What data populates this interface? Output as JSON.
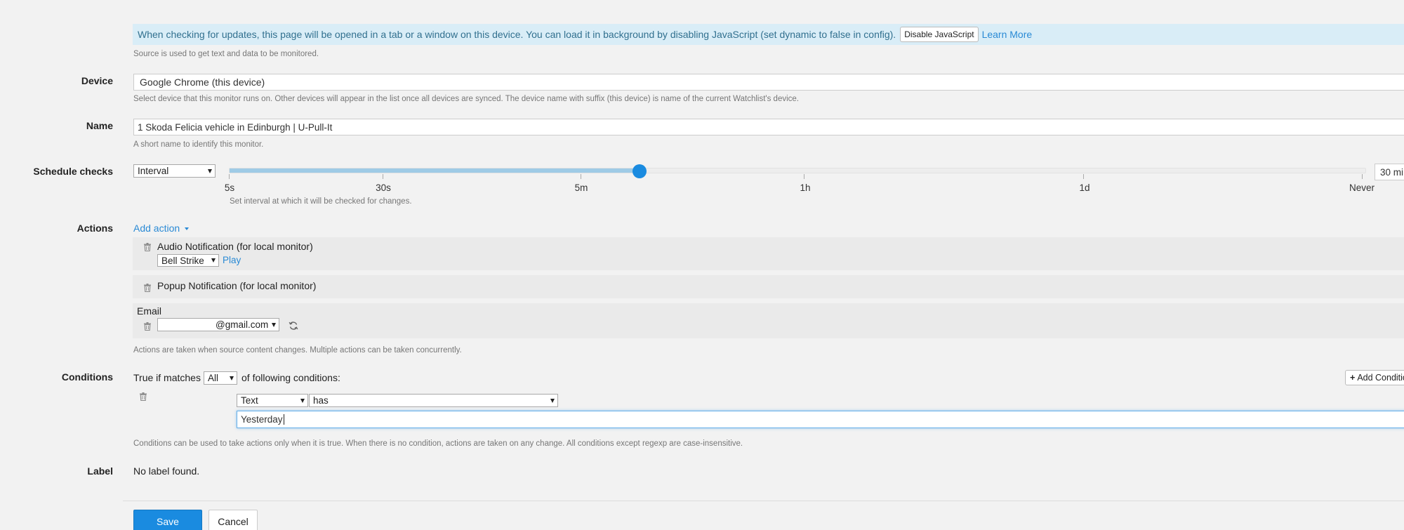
{
  "info": {
    "message": "When checking for updates, this page will be opened in a tab or a window on this device. You can load it in background by disabling JavaScript (set dynamic to false in config).",
    "disable_js_label": "Disable JavaScript",
    "learn_more_label": "Learn More",
    "help": "Source is used to get text and data to be monitored."
  },
  "device": {
    "label": "Device",
    "value": "Google Chrome (this device)",
    "help": "Select device that this monitor runs on. Other devices will appear in the list once all devices are synced. The device name with suffix (this device) is name of the current Watchlist's device."
  },
  "name": {
    "label": "Name",
    "value": "1 Skoda Felicia vehicle in Edinburgh | U-Pull-It",
    "help": "A short name to identify this monitor."
  },
  "schedule": {
    "label": "Schedule checks",
    "mode": "Interval",
    "ticks": [
      "5s",
      "30s",
      "5m",
      "1h",
      "1d",
      "Never"
    ],
    "slider_fraction": 0.361,
    "value": "30 mi",
    "help": "Set interval at which it will be checked for changes."
  },
  "actions": {
    "label": "Actions",
    "add_label": "Add action",
    "audio": {
      "title": "Audio Notification (for local monitor)",
      "sound": "Bell Strike",
      "play_label": "Play"
    },
    "popup": {
      "title": "Popup Notification (for local monitor)"
    },
    "email": {
      "title": "Email",
      "address": "@gmail.com"
    },
    "help": "Actions are taken when source content changes. Multiple actions can be taken concurrently."
  },
  "conditions": {
    "label": "Conditions",
    "prefix": "True if matches",
    "match_mode": "All",
    "suffix": "of following conditions:",
    "add_label": "Add Conditio",
    "rule": {
      "field": "Text",
      "operator": "has",
      "value": "Yesterday"
    },
    "help": "Conditions can be used to take actions only when it is true. When there is no condition, actions are taken on any change. All conditions except regexp are case-insensitive."
  },
  "label_row": {
    "label": "Label",
    "value": "No label found."
  },
  "footer": {
    "save_label": "Save",
    "cancel_label": "Cancel"
  },
  "colors": {
    "accent": "#1a8be0",
    "banner_bg": "#d9edf7",
    "link": "#2a8ad5"
  }
}
